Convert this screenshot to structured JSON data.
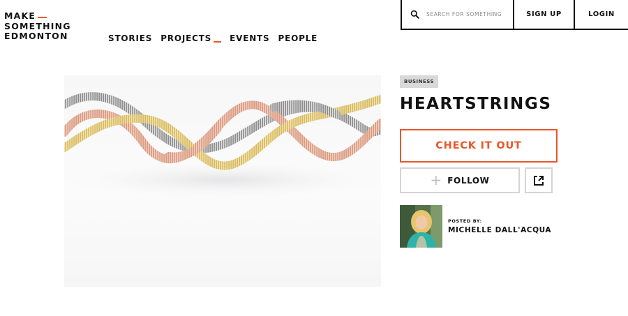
{
  "logo": {
    "line1": "MAKE",
    "line2": "SOMETHING",
    "line3": "EDMONTON"
  },
  "nav": {
    "items": [
      {
        "label": "STORIES",
        "active": false
      },
      {
        "label": "PROJECTS",
        "active": true
      },
      {
        "label": "EVENTS",
        "active": false
      },
      {
        "label": "PEOPLE",
        "active": false
      }
    ]
  },
  "topbar": {
    "search_placeholder": "SEARCH FOR SOMETHING",
    "search_icon": "search-icon",
    "signup_label": "SIGN UP",
    "login_label": "LOGIN"
  },
  "project": {
    "category": "BUSINESS",
    "title": "HEARTSTRINGS",
    "check_label": "CHECK IT OUT",
    "follow_label": "FOLLOW",
    "follow_icon": "plus-icon",
    "external_icon": "external-link-icon"
  },
  "author": {
    "posted_by_label": "POSTED BY:",
    "name": "MICHELLE DALL'ACQUA"
  },
  "colors": {
    "accent": "#e8572a",
    "text": "#111111",
    "badge_bg": "#d9d9d9",
    "border_light": "#d4d4d4"
  }
}
